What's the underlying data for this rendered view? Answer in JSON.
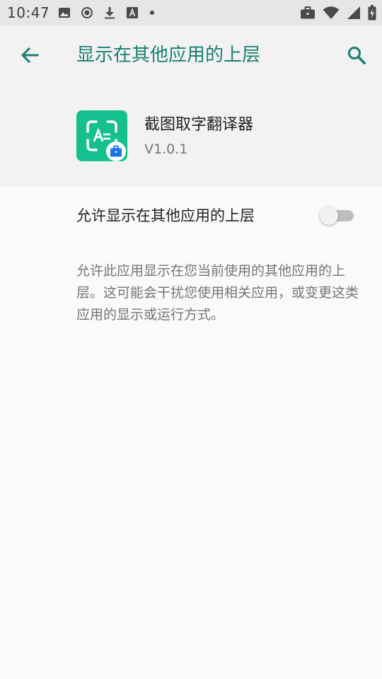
{
  "status_bar": {
    "time": "10:47",
    "left_icons": [
      "image-icon",
      "record-icon",
      "download-icon",
      "font-icon",
      "dot-icon"
    ],
    "right_icons": [
      "briefcase-icon",
      "wifi-icon",
      "signal-icon",
      "battery-icon"
    ]
  },
  "toolbar": {
    "title": "显示在其他应用的上层",
    "back_icon": "arrow-back-icon",
    "search_icon": "search-icon"
  },
  "app": {
    "name": "截图取字翻译器",
    "version": "V1.0.1",
    "icon_color": "#14c08d",
    "badge_icon": "work-briefcase-icon"
  },
  "setting": {
    "label": "允许显示在其他应用的上层",
    "enabled": false
  },
  "description": "允许此应用显示在您当前使用的其他应用的上层。这可能会干扰您使用相关应用，或变更这类应用的显示或运行方式。",
  "colors": {
    "accent": "#1a7f74",
    "status_bar_bg": "#e6e6e6",
    "header_bg": "#f2f2f2",
    "page_bg": "#fafafa"
  }
}
